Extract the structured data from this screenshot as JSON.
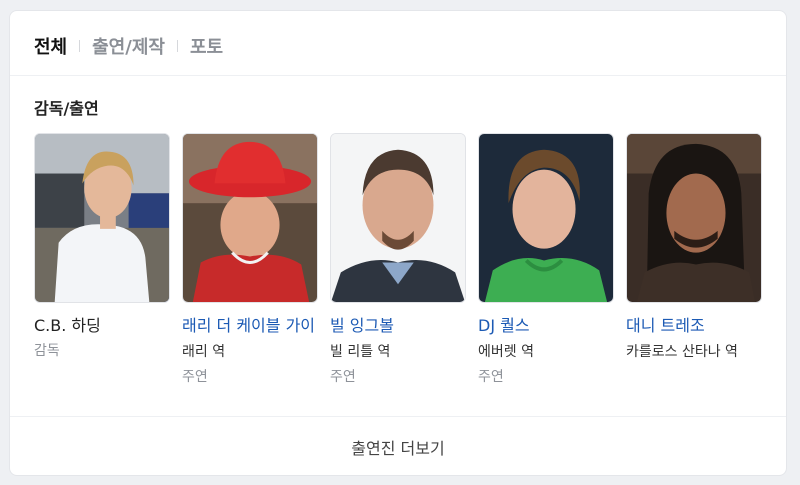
{
  "tabs": [
    {
      "label": "전체",
      "active": true
    },
    {
      "label": "출연/제작",
      "active": false
    },
    {
      "label": "포토",
      "active": false
    }
  ],
  "section_title": "감독/출연",
  "people": [
    {
      "name": "C.B. 하딩",
      "role": "",
      "kind": "감독",
      "link": false
    },
    {
      "name": "래리 더 케이블 가이",
      "role": "래리 역",
      "kind": "주연",
      "link": true
    },
    {
      "name": "빌 잉그볼",
      "role": "빌 리틀 역",
      "kind": "주연",
      "link": true
    },
    {
      "name": "DJ 퀄스",
      "role": "에버렛 역",
      "kind": "주연",
      "link": true
    },
    {
      "name": "대니 트레조",
      "role": "카를로스 산타나 역",
      "kind": "",
      "link": true
    }
  ],
  "more_label": "출연진 더보기",
  "colors": {
    "link": "#1c5ab4",
    "muted": "#8e9299",
    "active_tab": "#111111"
  }
}
